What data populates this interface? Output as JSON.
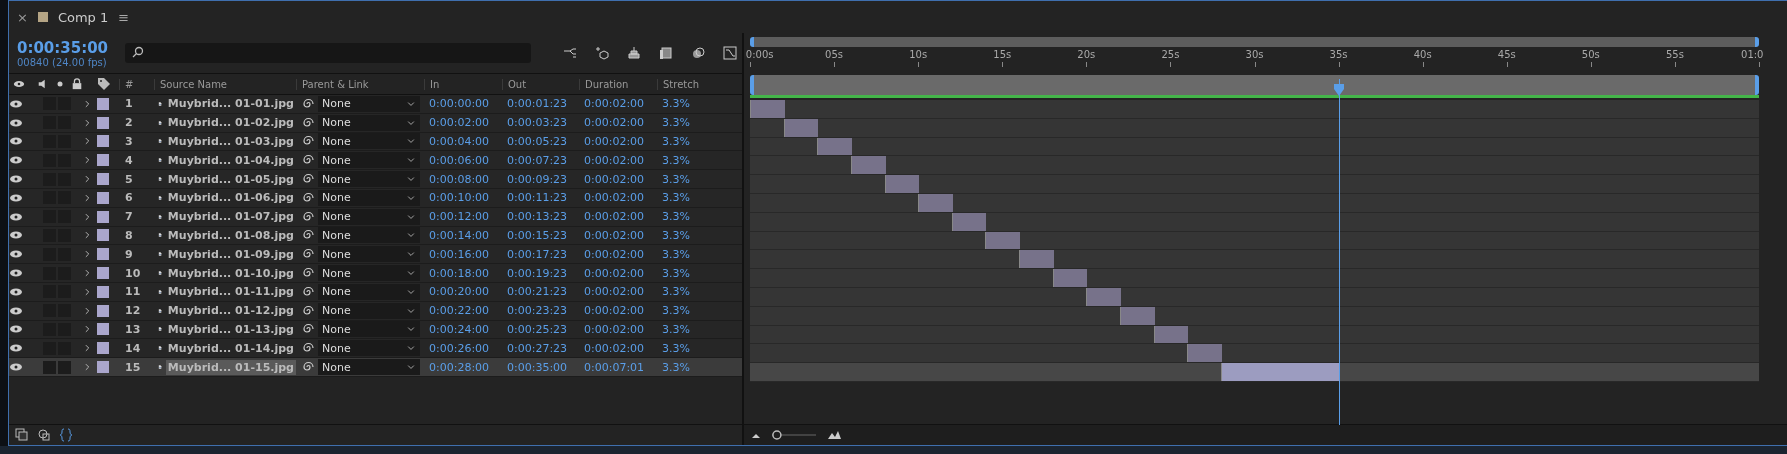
{
  "tab": {
    "close": "×",
    "title": "Comp 1",
    "menu": "≡"
  },
  "zoom": {
    "level": 0.05
  },
  "time": {
    "current": "0:00:35:00",
    "frames": "00840 (24.00 fps)"
  },
  "columns": [
    "#",
    "Source Name",
    "Parent & Link",
    "In",
    "Out",
    "Duration",
    "Stretch"
  ],
  "layers": [
    {
      "number": "1",
      "name": "Muybrid... 01-01.jpg",
      "parent": "None",
      "in": "0:00:00:00",
      "out": "0:00:01:23",
      "duration": "0:00:02:00",
      "stretch": "3.3%",
      "selected": false
    },
    {
      "number": "2",
      "name": "Muybrid... 01-02.jpg",
      "parent": "None",
      "in": "0:00:02:00",
      "out": "0:00:03:23",
      "duration": "0:00:02:00",
      "stretch": "3.3%",
      "selected": false
    },
    {
      "number": "3",
      "name": "Muybrid... 01-03.jpg",
      "parent": "None",
      "in": "0:00:04:00",
      "out": "0:00:05:23",
      "duration": "0:00:02:00",
      "stretch": "3.3%",
      "selected": false
    },
    {
      "number": "4",
      "name": "Muybrid... 01-04.jpg",
      "parent": "None",
      "in": "0:00:06:00",
      "out": "0:00:07:23",
      "duration": "0:00:02:00",
      "stretch": "3.3%",
      "selected": false
    },
    {
      "number": "5",
      "name": "Muybrid... 01-05.jpg",
      "parent": "None",
      "in": "0:00:08:00",
      "out": "0:00:09:23",
      "duration": "0:00:02:00",
      "stretch": "3.3%",
      "selected": false
    },
    {
      "number": "6",
      "name": "Muybrid... 01-06.jpg",
      "parent": "None",
      "in": "0:00:10:00",
      "out": "0:00:11:23",
      "duration": "0:00:02:00",
      "stretch": "3.3%",
      "selected": false
    },
    {
      "number": "7",
      "name": "Muybrid... 01-07.jpg",
      "parent": "None",
      "in": "0:00:12:00",
      "out": "0:00:13:23",
      "duration": "0:00:02:00",
      "stretch": "3.3%",
      "selected": false
    },
    {
      "number": "8",
      "name": "Muybrid... 01-08.jpg",
      "parent": "None",
      "in": "0:00:14:00",
      "out": "0:00:15:23",
      "duration": "0:00:02:00",
      "stretch": "3.3%",
      "selected": false
    },
    {
      "number": "9",
      "name": "Muybrid... 01-09.jpg",
      "parent": "None",
      "in": "0:00:16:00",
      "out": "0:00:17:23",
      "duration": "0:00:02:00",
      "stretch": "3.3%",
      "selected": false
    },
    {
      "number": "10",
      "name": "Muybrid... 01-10.jpg",
      "parent": "None",
      "in": "0:00:18:00",
      "out": "0:00:19:23",
      "duration": "0:00:02:00",
      "stretch": "3.3%",
      "selected": false
    },
    {
      "number": "11",
      "name": "Muybrid... 01-11.jpg",
      "parent": "None",
      "in": "0:00:20:00",
      "out": "0:00:21:23",
      "duration": "0:00:02:00",
      "stretch": "3.3%",
      "selected": false
    },
    {
      "number": "12",
      "name": "Muybrid... 01-12.jpg",
      "parent": "None",
      "in": "0:00:22:00",
      "out": "0:00:23:23",
      "duration": "0:00:02:00",
      "stretch": "3.3%",
      "selected": false
    },
    {
      "number": "13",
      "name": "Muybrid... 01-13.jpg",
      "parent": "None",
      "in": "0:00:24:00",
      "out": "0:00:25:23",
      "duration": "0:00:02:00",
      "stretch": "3.3%",
      "selected": false
    },
    {
      "number": "14",
      "name": "Muybrid... 01-14.jpg",
      "parent": "None",
      "in": "0:00:26:00",
      "out": "0:00:27:23",
      "duration": "0:00:02:00",
      "stretch": "3.3%",
      "selected": false
    },
    {
      "number": "15",
      "name": "Muybrid... 01-15.jpg",
      "parent": "None",
      "in": "0:00:28:00",
      "out": "0:00:35:00",
      "duration": "0:00:07:01",
      "stretch": "3.3%",
      "selected": true
    }
  ],
  "ruler": [
    "0:00s",
    "05s",
    "10s",
    "15s",
    "20s",
    "25s",
    "30s",
    "35s",
    "40s",
    "45s",
    "50s",
    "55s",
    "01:0"
  ]
}
